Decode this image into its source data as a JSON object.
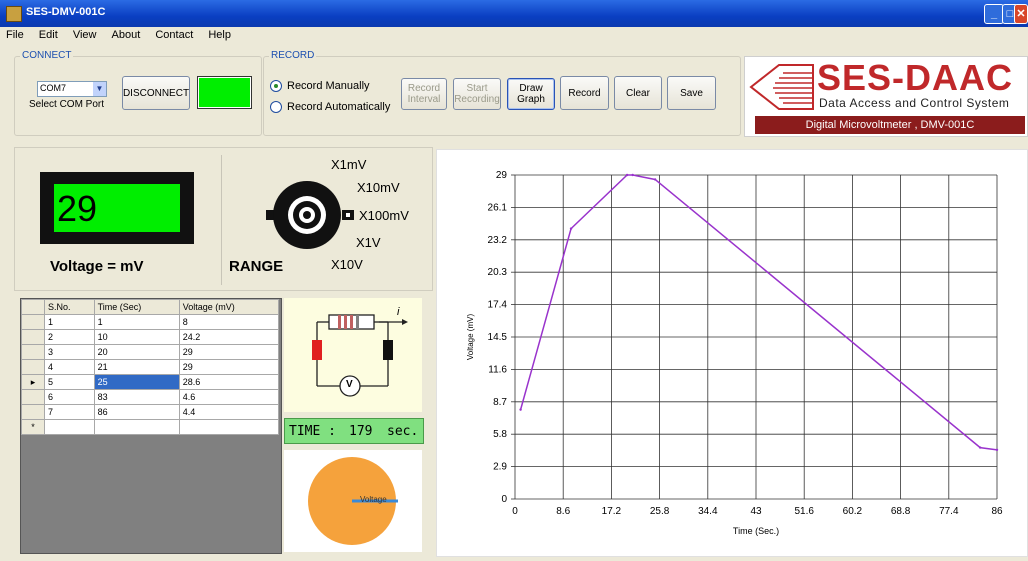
{
  "window": {
    "title": "SES-DMV-001C"
  },
  "menu": [
    "File",
    "Edit",
    "View",
    "About",
    "Contact",
    "Help"
  ],
  "connect": {
    "group_label": "CONNECT",
    "com_port": "COM7",
    "com_port_label": "Select COM Port",
    "disconnect_label": "DISCONNECT",
    "status_color": "#00ee00"
  },
  "record": {
    "group_label": "RECORD",
    "radio_manual": "Record Manually",
    "radio_auto": "Record Automatically",
    "selected": "manual",
    "btn_interval": "Record Interval",
    "btn_start": "Start Recording",
    "btn_draw": "Draw Graph",
    "btn_record": "Record",
    "btn_clear": "Clear",
    "btn_save": "Save"
  },
  "logo": {
    "brand": "SES-DAAC",
    "tagline": "Data Access and Control System",
    "product": "Digital Microvoltmeter , DMV-001C",
    "accent": "#c0282a"
  },
  "meter": {
    "display_value": "29",
    "display_color": "#00ee00",
    "unit_label": "Voltage  =  mV",
    "range_label": "RANGE",
    "ranges": [
      "X1mV",
      "X10mV",
      "X100mV",
      "X1V",
      "X10V"
    ]
  },
  "table": {
    "columns": [
      "S.No.",
      "Time (Sec)",
      "Voltage (mV)"
    ],
    "rows": [
      [
        "1",
        "1",
        "8"
      ],
      [
        "2",
        "10",
        "24.2"
      ],
      [
        "3",
        "20",
        "29"
      ],
      [
        "4",
        "21",
        "29"
      ],
      [
        "5",
        "25",
        "28.6"
      ],
      [
        "6",
        "83",
        "4.6"
      ],
      [
        "7",
        "86",
        "4.4"
      ]
    ],
    "selected_row": 4,
    "new_row_marker": "*",
    "current_row_marker": "▸"
  },
  "circuit": {
    "current_label": "i",
    "meter_symbol": "V"
  },
  "time_display": {
    "label": "TIME :",
    "value": "179",
    "unit": "sec.",
    "color": "#80e080"
  },
  "gauge": {
    "label": "Voltage",
    "color": "#f5a23c"
  },
  "chart_data": {
    "type": "line",
    "x": [
      1,
      10,
      20,
      21,
      25,
      83,
      86
    ],
    "y": [
      8,
      24.2,
      29,
      29,
      28.6,
      4.6,
      4.4
    ],
    "xlabel": "Time (Sec.)",
    "ylabel": "Voltage (mV)",
    "xlim": [
      0,
      86
    ],
    "ylim": [
      0,
      29
    ],
    "xticks": [
      "0",
      "8.6",
      "17.2",
      "25.8",
      "34.4",
      "43",
      "51.6",
      "60.2",
      "68.8",
      "77.4",
      "86"
    ],
    "yticks": [
      "0",
      "2.9",
      "5.8",
      "8.7",
      "11.6",
      "14.5",
      "17.4",
      "20.3",
      "23.2",
      "26.1",
      "29"
    ],
    "grid": true,
    "line_color": "#9933cc"
  }
}
